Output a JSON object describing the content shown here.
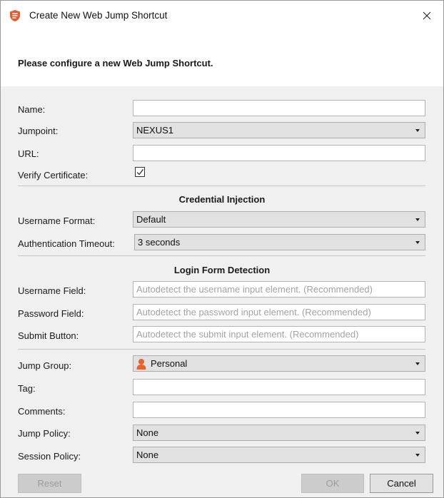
{
  "window": {
    "title": "Create New Web Jump Shortcut",
    "heading": "Please configure a new Web Jump Shortcut."
  },
  "form": {
    "name": {
      "label": "Name:",
      "value": ""
    },
    "jumpoint": {
      "label": "Jumpoint:",
      "value": "NEXUS1"
    },
    "url": {
      "label": "URL:",
      "value": ""
    },
    "verify_certificate": {
      "label": "Verify Certificate:",
      "checked": true
    },
    "credential_section": "Credential Injection",
    "username_format": {
      "label": "Username Format:",
      "value": "Default"
    },
    "auth_timeout": {
      "label": "Authentication Timeout:",
      "value": "3 seconds"
    },
    "login_section": "Login Form Detection",
    "username_field": {
      "label": "Username Field:",
      "placeholder": "Autodetect the username input element. (Recommended)"
    },
    "password_field": {
      "label": "Password Field:",
      "placeholder": "Autodetect the password input element. (Recommended)"
    },
    "submit_button": {
      "label": "Submit Button:",
      "placeholder": "Autodetect the submit input element. (Recommended)"
    },
    "jump_group": {
      "label": "Jump Group:",
      "value": "Personal"
    },
    "tag": {
      "label": "Tag:",
      "value": ""
    },
    "comments": {
      "label": "Comments:",
      "value": ""
    },
    "jump_policy": {
      "label": "Jump Policy:",
      "value": "None"
    },
    "session_policy": {
      "label": "Session Policy:",
      "value": "None"
    }
  },
  "buttons": {
    "reset": "Reset",
    "ok": "OK",
    "cancel": "Cancel"
  },
  "colors": {
    "app_icon": "#e8592b",
    "person_icon": "#e8622b",
    "separator": "#c6c6c6"
  },
  "icons": {
    "app": "bomgar-shield-icon",
    "close": "close-icon",
    "check": "checkmark-icon",
    "dropdown": "chevron-down-icon",
    "group": "person-icon"
  }
}
